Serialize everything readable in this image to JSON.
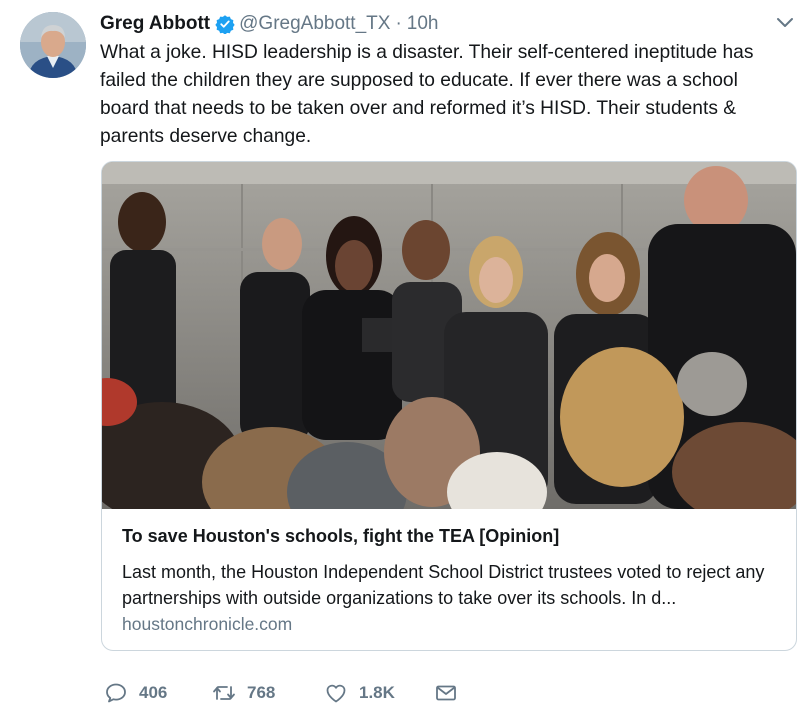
{
  "tweet": {
    "author_name": "Greg Abbott",
    "handle": "@GregAbbott_TX",
    "separator": "·",
    "time": "10h",
    "text": "What a joke. HISD leadership is a disaster. Their self-centered ineptitude has failed the children they are supposed to educate. If ever there was a school board that needs to be taken over and reformed it’s HISD. Their students & parents deserve change."
  },
  "card": {
    "title": "To save Houston's schools, fight the TEA [Opinion]",
    "description": "Last month, the Houston Independent School District trustees voted to reject any partnerships with outside organizations to take over its schools. In d...",
    "domain": "houstonchronicle.com"
  },
  "actions": {
    "replies": "406",
    "retweets": "768",
    "likes": "1.8K"
  },
  "icons": [
    "verified-badge-icon",
    "chevron-down-icon",
    "reply-icon",
    "retweet-icon",
    "like-icon",
    "message-icon"
  ],
  "colors": {
    "verified": "#1da1f2",
    "muted": "#657786",
    "text": "#14171a",
    "border": "#ccd6dd"
  }
}
